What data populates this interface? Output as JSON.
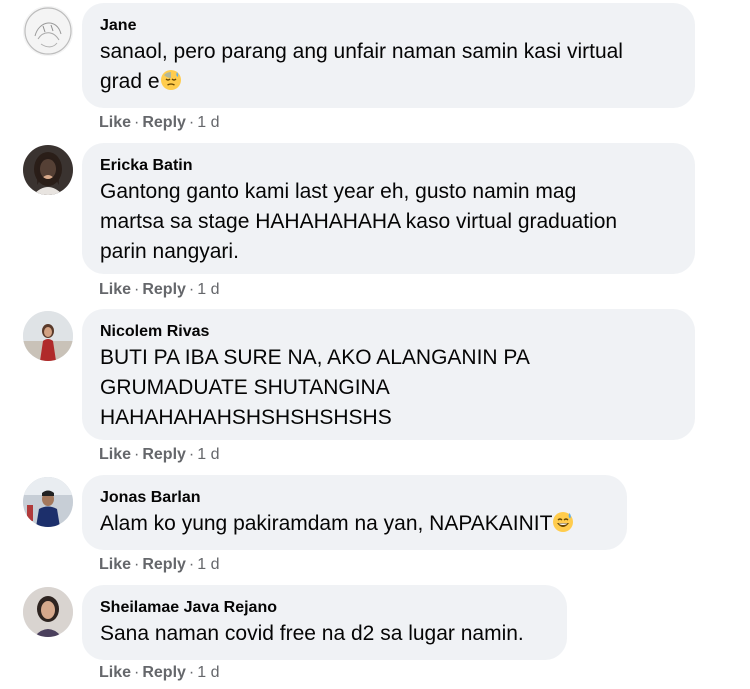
{
  "comments": [
    {
      "author": "Jane",
      "lines": [
        "sanaol, pero parang ang unfair naman samin kasi virtual",
        "grad e"
      ],
      "emoji": "downcast-sweat-face-emoji",
      "like": "Like",
      "reply": "Reply",
      "time": "1 d"
    },
    {
      "author": "Ericka Batin",
      "lines": [
        "Gantong ganto kami last year eh, gusto namin mag",
        "martsa sa stage HAHAHAHAHA kaso virtual graduation",
        "parin nangyari."
      ],
      "like": "Like",
      "reply": "Reply",
      "time": "1 d"
    },
    {
      "author": "Nicolem Rivas",
      "lines": [
        "BUTI PA IBA SURE NA, AKO ALANGANIN PA",
        "GRUMADUATE SHUTANGINA",
        "HAHAHAHAHSHSHSHSHSHS"
      ],
      "like": "Like",
      "reply": "Reply",
      "time": "1 d"
    },
    {
      "author": "Jonas Barlan",
      "lines": [
        "Alam ko yung pakiramdam na yan, NAPAKAINIT"
      ],
      "emoji": "grinning-sweat-face-emoji",
      "like": "Like",
      "reply": "Reply",
      "time": "1 d"
    },
    {
      "author": "Sheilamae Java Rejano",
      "lines": [
        "Sana naman covid free na d2 sa lugar namin."
      ],
      "like": "Like",
      "reply": "Reply",
      "time": "1 d"
    }
  ],
  "separator": "·",
  "colors": {
    "bubble": "#f0f2f5",
    "text": "#050505",
    "meta": "#65676b"
  }
}
